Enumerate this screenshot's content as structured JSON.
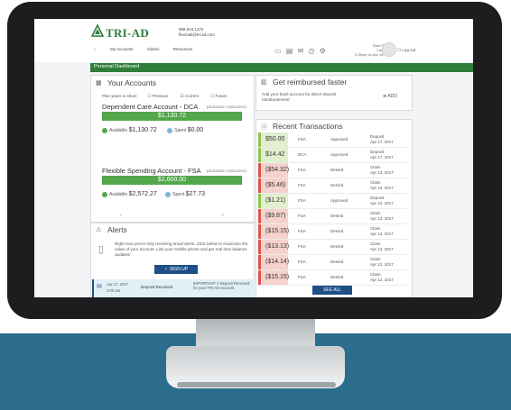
{
  "brand": {
    "name": "TRI-AD",
    "phone": "888.844.1372",
    "email": "flexmail@tri-ad.com"
  },
  "nav": [
    "My Accounts",
    "Claims",
    "Resources"
  ],
  "user": {
    "name": "Sam Sample",
    "last_login": "Last login:",
    "last_login_value": "3:35pm on Apr 18, 2017"
  },
  "logout": "Log out",
  "dashboard_label": "Personal Dashboard",
  "accounts": {
    "title": "Your Accounts",
    "plan_years_label": "Plan years to show:",
    "plan_years": [
      "Previous",
      "Current",
      "Future"
    ],
    "items": [
      {
        "name": "Dependent Care Account - DCA",
        "dates": "(01/01/2017 12/31/2017)",
        "total": "$1,130.72",
        "available_label": "Available",
        "available": "$1,130.72",
        "spent_label": "Spent",
        "spent": "$0.00"
      },
      {
        "name": "Flexible Spending Account - FSA",
        "dates": "(01/01/2017 12/31/2017)",
        "total": "$2,600.00",
        "available_label": "Available",
        "available": "$2,572.27",
        "spent_label": "Spent",
        "spent": "$27.73"
      }
    ]
  },
  "reimburse": {
    "title": "Get reimbursed faster",
    "text": "Add your bank account for direct deposit reimbursement",
    "add_label": "ADD"
  },
  "alerts": {
    "title": "Alerts",
    "text": "Right now you're only receiving email alerts. Click below to maximize the value of your account. Link your mobile phone and get real time balance updates!",
    "signup_label": "SIGN UP",
    "item": {
      "date": "Apr 17, 2017",
      "time": "2:00 am",
      "label": "Deposit Received",
      "message": "IMPORTANT: A Deposit Received for your TRI-AD Account"
    }
  },
  "transactions": {
    "title": "Recent Transactions",
    "see_all": "SEE ALL",
    "rows": [
      {
        "amount": "$50.00",
        "type": "FSA",
        "status": "Approved",
        "desc": "Deposit",
        "date": "Apr 17, 2017",
        "kind": "pos"
      },
      {
        "amount": "$14.42",
        "type": "DCA",
        "status": "Approved",
        "desc": "Deposit",
        "date": "Apr 17, 2017",
        "kind": "pos"
      },
      {
        "amount": "($54.32)",
        "type": "FSA",
        "status": "Denied",
        "desc": "Claim",
        "date": "Apr 12, 2017",
        "kind": "neg"
      },
      {
        "amount": "($5.46)",
        "type": "FSA",
        "status": "Denied",
        "desc": "Claim",
        "date": "Apr 12, 2017",
        "kind": "neg"
      },
      {
        "amount": "($1.21)",
        "type": "FSA",
        "status": "Approved",
        "desc": "Deposit",
        "date": "Apr 12, 2017",
        "kind": "pos"
      },
      {
        "amount": "($9.87)",
        "type": "FSA",
        "status": "Denied",
        "desc": "Claim",
        "date": "Apr 12, 2017",
        "kind": "neg"
      },
      {
        "amount": "($15.15)",
        "type": "FSA",
        "status": "Denied",
        "desc": "Claim",
        "date": "Apr 12, 2017",
        "kind": "neg"
      },
      {
        "amount": "($13.13)",
        "type": "FSA",
        "status": "Denied",
        "desc": "Claim",
        "date": "Apr 12, 2017",
        "kind": "neg"
      },
      {
        "amount": "($14.14)",
        "type": "FSA",
        "status": "Denied",
        "desc": "Claim",
        "date": "Apr 12, 2017",
        "kind": "neg"
      },
      {
        "amount": "($15.15)",
        "type": "FSA",
        "status": "Denied",
        "desc": "Claim",
        "date": "Apr 12, 2017",
        "kind": "neg"
      }
    ]
  }
}
